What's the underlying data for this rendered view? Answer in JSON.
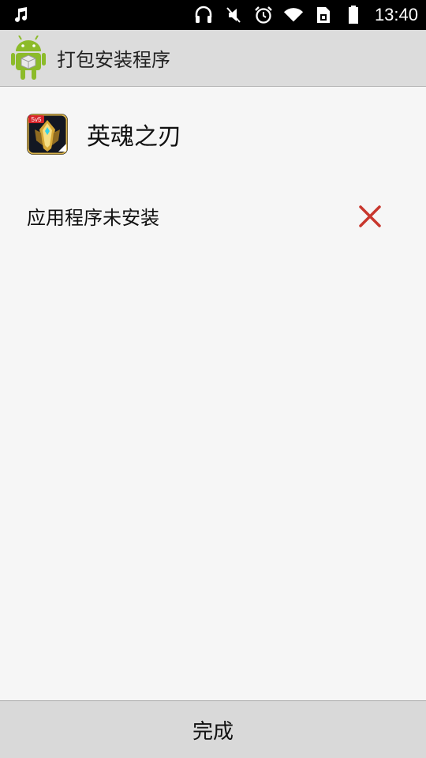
{
  "status_bar": {
    "time": "13:40",
    "icons": [
      "music-note-icon",
      "headphones-icon",
      "vibrate-off-icon",
      "alarm-icon",
      "wifi-icon",
      "sim-icon",
      "battery-icon"
    ]
  },
  "action_bar": {
    "title": "打包安装程序",
    "icon": "android-installer-icon"
  },
  "app": {
    "name": "英魂之刃",
    "icon": "game-app-icon",
    "icon_badge": "5v5"
  },
  "result": {
    "message": "应用程序未安装",
    "status_icon": "close-icon",
    "status_color": "#c8372d"
  },
  "footer": {
    "done_label": "完成"
  }
}
